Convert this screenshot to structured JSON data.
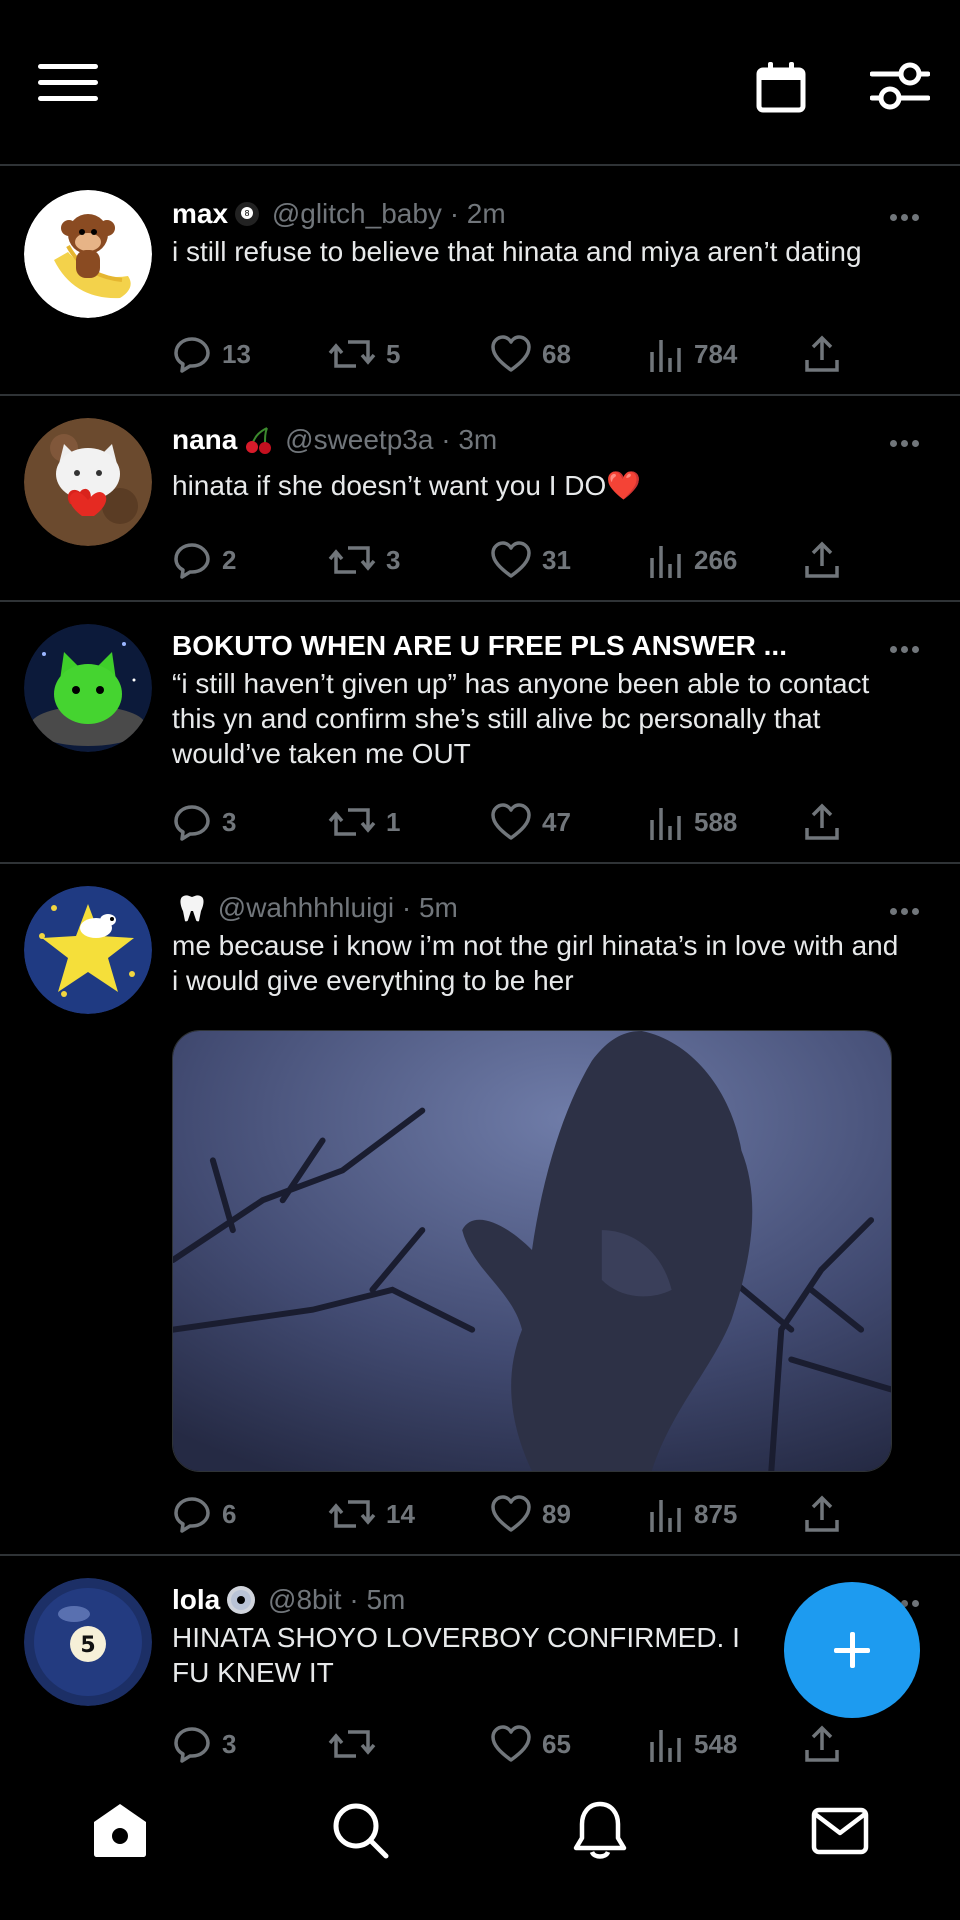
{
  "tweets": [
    {
      "name": "max",
      "name_emoji": "8-ball",
      "handle": "@glitch_baby",
      "time": "· 2m",
      "text": "i still refuse to believe that hinata and miya aren’t dating",
      "replies": "13",
      "retweets": "5",
      "likes": "68",
      "views": "784",
      "avatar": "monkey-banana-avatar"
    },
    {
      "name": "nana",
      "name_emoji": "cherries",
      "handle": "@sweetp3a",
      "time": "· 3m",
      "text": "hinata if she doesn’t want you I DO❤️",
      "replies": "2",
      "retweets": "3",
      "likes": "31",
      "views": "266",
      "avatar": "cat-heart-avatar"
    },
    {
      "name": "BOKUTO WHEN ARE U FREE PLS ANSWER ...",
      "handle": "",
      "time": "",
      "text": "“i still haven’t given up” has anyone been able to contact this yn and confirm she’s still alive bc personally that would’ve taken me OUT",
      "replies": "3",
      "retweets": "1",
      "likes": "47",
      "views": "588",
      "avatar": "green-cat-avatar"
    },
    {
      "name": "",
      "name_emoji": "tooth",
      "handle": "@wahhhhluigi",
      "time": "· 5m",
      "text": "me because i know i’m not the girl hinata’s in love with and i would give everything to be her",
      "replies": "6",
      "retweets": "14",
      "likes": "89",
      "views": "875",
      "avatar": "star-snoopy-avatar",
      "media": "gorilla-in-dark-forest-image"
    },
    {
      "name": "lola",
      "name_emoji": "cd",
      "handle": "@8bit",
      "time": "· 5m",
      "text": "HINATA SHOYO LOVERBOY CONFIRMED. I FU KNEW IT",
      "replies": "3",
      "retweets": "",
      "likes": "65",
      "views": "548",
      "avatar": "pool-ball-5-avatar"
    }
  ],
  "colors": {
    "background": "#000000",
    "accent": "#1d9bf0",
    "secondary_text": "#71767b",
    "divider": "#2f3336"
  },
  "icons": {
    "top_left": "hamburger-menu-icon",
    "top_right_1": "calendar-icon",
    "top_right_2": "filter-sliders-icon",
    "fab": "compose-plus-icon",
    "nav": [
      "home-icon",
      "search-icon",
      "bell-icon",
      "mail-icon"
    ]
  }
}
